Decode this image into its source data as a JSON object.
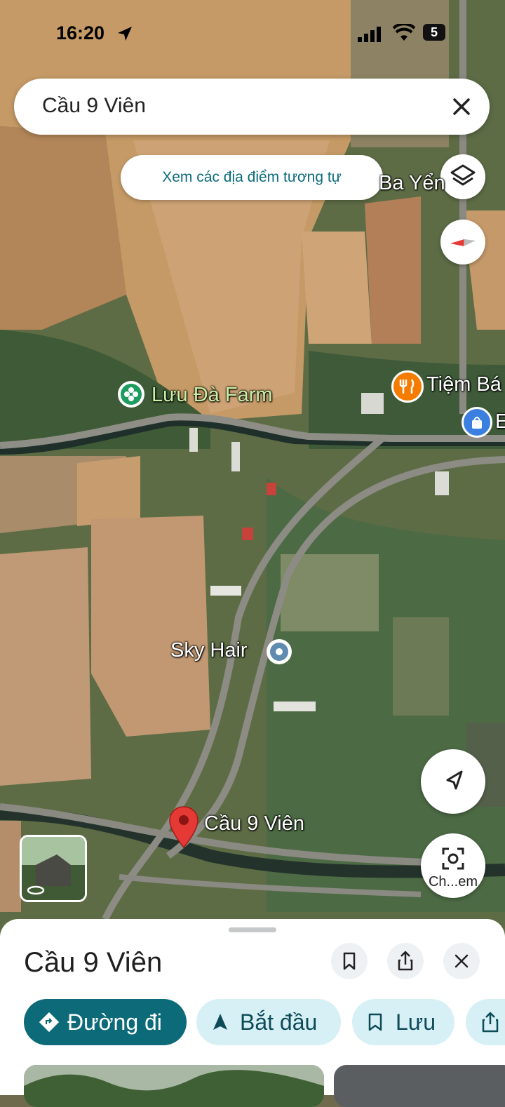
{
  "status_bar": {
    "time": "16:20",
    "battery": "5"
  },
  "search": {
    "query": "Cầu 9 Viên"
  },
  "map": {
    "similar_places_button": "Xem các địa điểm tương tự",
    "labels": {
      "ba_yen": "Ba Yển",
      "luu_da_farm": "Lưu Đà Farm",
      "tiem": "Tiệm Bá",
      "e_cut": "E",
      "sky_hair": "Sky Hair",
      "pin": "Cầu 9 Viên"
    },
    "camera_label": "Ch...em"
  },
  "sheet": {
    "title": "Cầu 9 Viên",
    "chips": {
      "directions": "Đường đi",
      "start": "Bắt đầu",
      "save": "Lưu"
    }
  },
  "colors": {
    "primary": "#0d6a78",
    "chip_secondary": "#d7f0f6",
    "pin": "#e53935"
  }
}
